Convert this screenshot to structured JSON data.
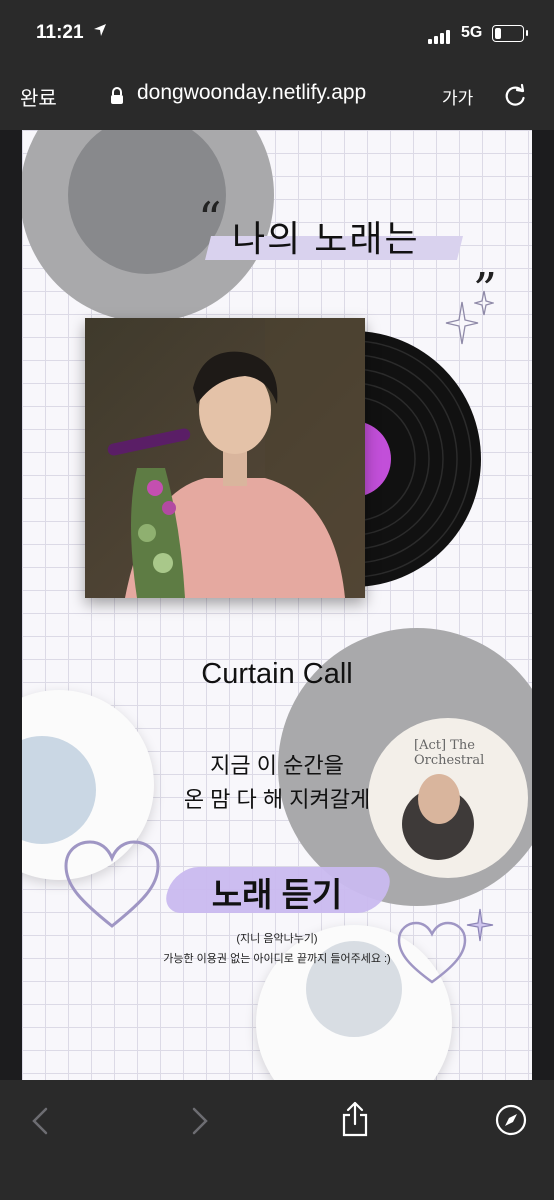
{
  "status_bar": {
    "time": "11:21",
    "network": "5G"
  },
  "browser": {
    "done_label": "완료",
    "url": "dongwoonday.netlify.app",
    "text_size_label": "가가"
  },
  "page": {
    "open_quote": "“",
    "close_quote": "„",
    "title": "나의 노래는",
    "song_title": "Curtain Call",
    "lyric_line1": "지금 이 순간을",
    "lyric_line2": "온 맘 다 해 지켜갈게",
    "listen_button": "노래 듣기",
    "note_line1": "(지니 음악나누기)",
    "note_line2": "가능한 이용권 없는 아이디로 끝까지 들어주세요 :)",
    "album_disc_label": "[Act] The Orchestral",
    "accent_color": "#c9b9ef"
  },
  "icons": [
    "location-arrow-icon",
    "signal-icon",
    "battery-icon",
    "lock-icon",
    "reload-icon",
    "back-icon",
    "forward-icon",
    "share-icon",
    "compass-icon",
    "heart-icon",
    "sparkle-icon",
    "vinyl-record-icon"
  ]
}
